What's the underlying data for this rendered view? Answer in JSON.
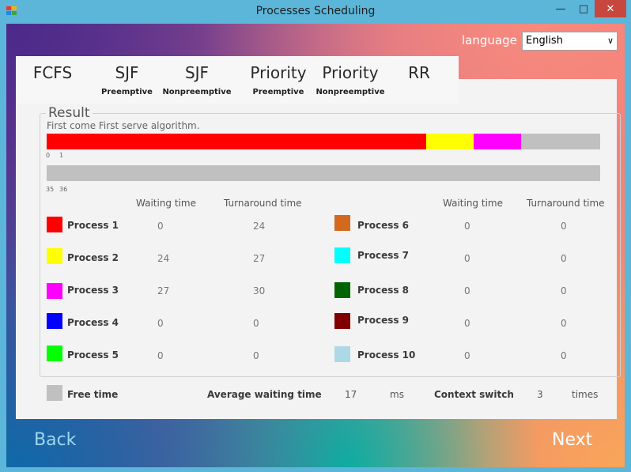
{
  "window": {
    "title": "Processes Scheduling",
    "minimize": "—",
    "maximize": "□",
    "close": "✕"
  },
  "language": {
    "label": "language",
    "selected": "English",
    "caret": "∨"
  },
  "tabs": [
    {
      "label": "FCFS",
      "sub": ""
    },
    {
      "label": "SJF",
      "sub": "Preemptive"
    },
    {
      "label": "SJF",
      "sub": "Nonpreemptive"
    },
    {
      "label": "Priority",
      "sub": "Preemptive"
    },
    {
      "label": "Priority",
      "sub": "Nonpreemptive"
    },
    {
      "label": "RR",
      "sub": ""
    }
  ],
  "result": {
    "legend": "Result",
    "description": "First come First serve algorithm.",
    "timeline_total": 35,
    "rows": [
      {
        "ticks": [
          "0",
          "1"
        ],
        "segments": [
          {
            "color": "#ff0000",
            "start": 0,
            "end": 24
          },
          {
            "color": "#ffff00",
            "start": 24,
            "end": 27
          },
          {
            "color": "#ff00ff",
            "start": 27,
            "end": 30
          },
          {
            "color": "#c0c0c0",
            "start": 30,
            "end": 35
          }
        ]
      },
      {
        "ticks": [
          "35",
          "36"
        ],
        "segments": []
      }
    ]
  },
  "columns": {
    "waiting": "Waiting time",
    "turnaround": "Turnaround time"
  },
  "processes": [
    {
      "name": "Process 1",
      "color": "#ff0000",
      "waiting": "0",
      "turnaround": "24"
    },
    {
      "name": "Process 2",
      "color": "#ffff00",
      "waiting": "24",
      "turnaround": "27"
    },
    {
      "name": "Process 3",
      "color": "#ff00ff",
      "waiting": "27",
      "turnaround": "30"
    },
    {
      "name": "Process 4",
      "color": "#0000ff",
      "waiting": "0",
      "turnaround": "0"
    },
    {
      "name": "Process 5",
      "color": "#00ff00",
      "waiting": "0",
      "turnaround": "0"
    },
    {
      "name": "Process 6",
      "color": "#d2691e",
      "waiting": "0",
      "turnaround": "0"
    },
    {
      "name": "Process 7",
      "color": "#00ffff",
      "waiting": "0",
      "turnaround": "0"
    },
    {
      "name": "Process 8",
      "color": "#006400",
      "waiting": "0",
      "turnaround": "0"
    },
    {
      "name": "Process 9",
      "color": "#800000",
      "waiting": "0",
      "turnaround": "0"
    },
    {
      "name": "Process 10",
      "color": "#add8e6",
      "waiting": "0",
      "turnaround": "0"
    }
  ],
  "footer": {
    "free_time_label": "Free time",
    "free_time_color": "#c0c0c0",
    "avg_wait_label": "Average waiting time",
    "avg_wait_value": "17",
    "avg_wait_unit": "ms",
    "context_switch_label": "Context switch",
    "context_switch_value": "3",
    "context_switch_unit": "times"
  },
  "nav": {
    "back": "Back",
    "next": "Next"
  }
}
